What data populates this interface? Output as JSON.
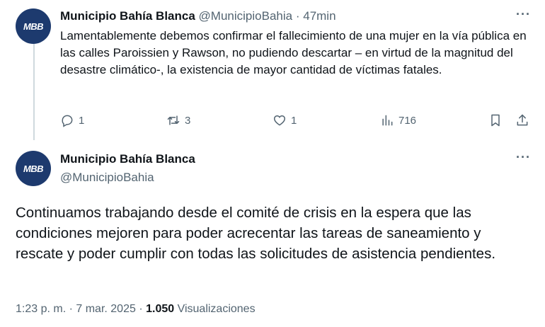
{
  "tweet1": {
    "avatar_text": "MBB",
    "name": "Municipio Bahía Blanca",
    "handle": "@MunicipioBahia",
    "separator": "·",
    "time": "47min",
    "more": "···",
    "text": "Lamentablemente debemos confirmar el fallecimiento de una mujer en la vía pública en las calles Paroissien y Rawson, no pudiendo descartar – en virtud de la magnitud del desastre climático-, la existencia de mayor cantidad de víctimas fatales.",
    "actions": {
      "replies": "1",
      "retweets": "3",
      "likes": "1",
      "views": "716"
    }
  },
  "tweet2": {
    "avatar_text": "MBB",
    "name": "Municipio Bahía Blanca",
    "handle": "@MunicipioBahia",
    "more": "···",
    "text": "Continuamos trabajando desde el comité de crisis en la espera que las condiciones mejoren para poder acrecentar las tareas de saneamiento y rescate y poder cumplir con todas las solicitudes de asistencia pendientes.",
    "meta": {
      "timestamp": "1:23 p. m. · 7 mar. 2025 · ",
      "views_count": "1.050",
      "views_label": " Visualizaciones"
    }
  },
  "colors": {
    "text": "#0f1419",
    "muted": "#536471",
    "avatar": "#1d3a6e",
    "thread_line": "#cfd9de"
  }
}
